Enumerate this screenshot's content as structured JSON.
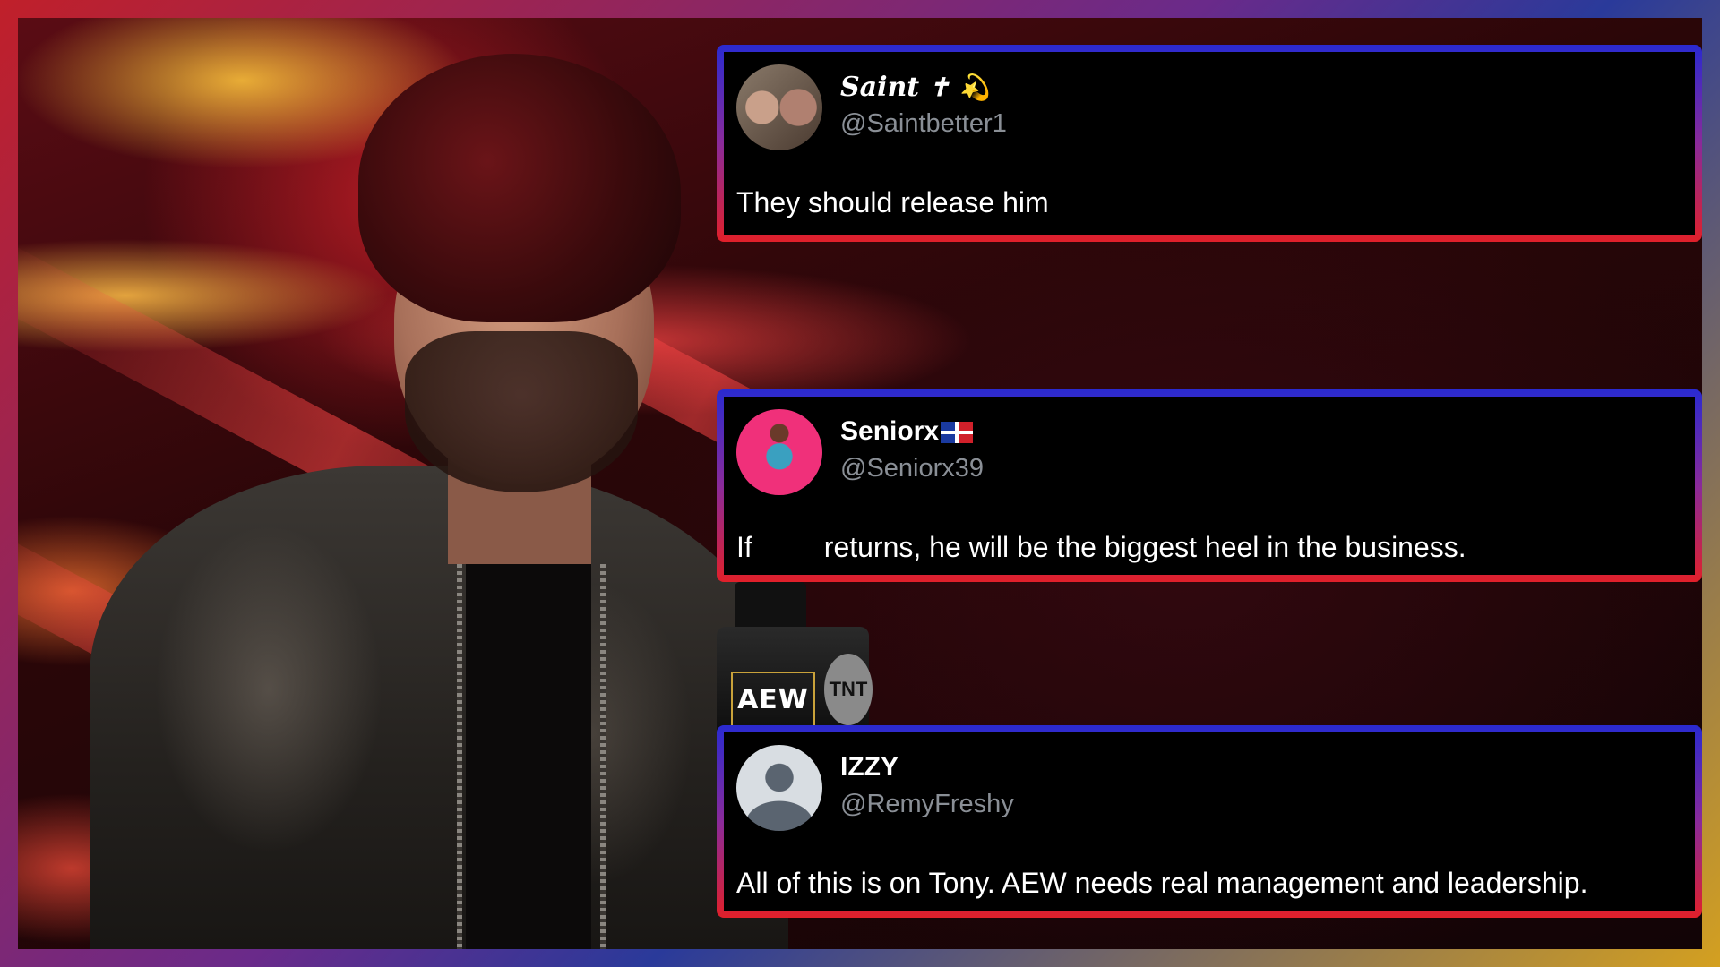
{
  "tweets": [
    {
      "display_name": "Saint",
      "name_emoji_1": "✝",
      "name_emoji_2": "💫",
      "handle": "@Saintbetter1",
      "text": "They should release him"
    },
    {
      "display_name": "Seniorx",
      "handle": "@Seniorx39",
      "text_prefix": "If",
      "text_suffix": "returns, he will be the biggest heel in the business."
    },
    {
      "display_name": "IZZY",
      "handle": "@RemyFreshy",
      "text": "All of this is on Tony. AEW needs real management and leadership."
    }
  ],
  "photo": {
    "mic_logo_1": "AEW",
    "mic_logo_2": "TNT"
  },
  "colors": {
    "card_border_top": "#2a2ad0",
    "card_border_bottom": "#e0202a",
    "frame_gradient": [
      "#c0202a",
      "#6a2a8a",
      "#2a3a9a",
      "#d4a020"
    ]
  }
}
